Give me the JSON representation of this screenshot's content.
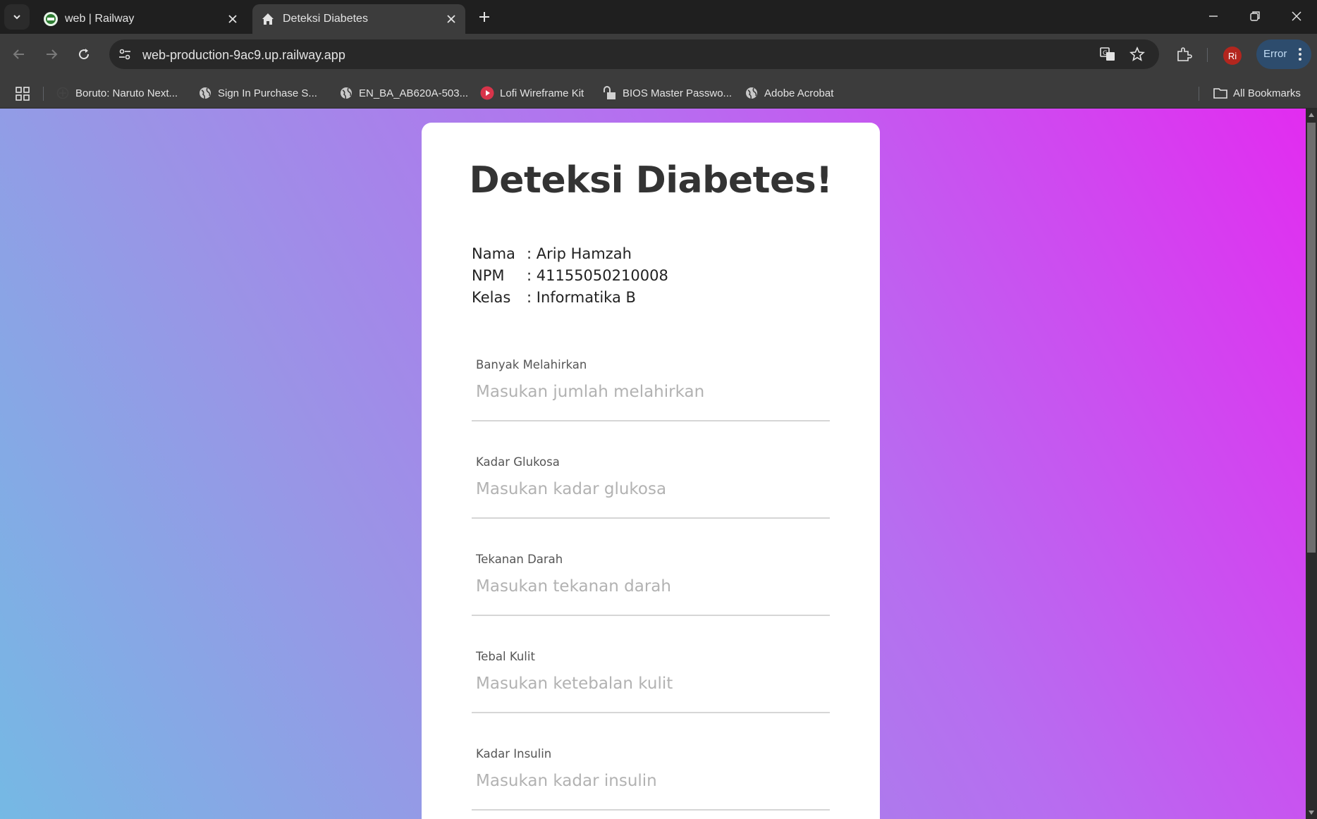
{
  "browser": {
    "tabs": [
      {
        "title": "web | Railway",
        "active": false,
        "favicon": "railway-icon"
      },
      {
        "title": "Deteksi Diabetes",
        "active": true,
        "favicon": "home-icon"
      }
    ],
    "url": "web-production-9ac9.up.railway.app",
    "profile_initials": "Ri",
    "status_chip": "Error",
    "bookmarks": [
      {
        "label": "Boruto: Naruto Next...",
        "icon": "plus-circle-icon"
      },
      {
        "label": "Sign In  Purchase  S...",
        "icon": "globe-icon"
      },
      {
        "label": "EN_BA_AB620A-503...",
        "icon": "globe-icon"
      },
      {
        "label": "Lofi Wireframe Kit",
        "icon": "play-icon"
      },
      {
        "label": "BIOS Master Passwo...",
        "icon": "lock-icon"
      },
      {
        "label": "Adobe Acrobat",
        "icon": "globe-icon"
      }
    ],
    "all_bookmarks": "All Bookmarks"
  },
  "page": {
    "title": "Deteksi Diabetes!",
    "info": [
      {
        "key": "Nama",
        "value": ": Arip Hamzah"
      },
      {
        "key": "NPM",
        "value": ": 41155050210008"
      },
      {
        "key": "Kelas",
        "value": ": Informatika B"
      }
    ],
    "fields": [
      {
        "label": "Banyak Melahirkan",
        "placeholder": "Masukan jumlah melahirkan",
        "value": ""
      },
      {
        "label": "Kadar Glukosa",
        "placeholder": "Masukan kadar glukosa",
        "value": ""
      },
      {
        "label": "Tekanan Darah",
        "placeholder": "Masukan tekanan darah",
        "value": ""
      },
      {
        "label": "Tebal Kulit",
        "placeholder": "Masukan ketebalan kulit",
        "value": ""
      },
      {
        "label": "Kadar Insulin",
        "placeholder": "Masukan kadar insulin",
        "value": ""
      }
    ]
  },
  "colors": {
    "gradient_start": "#75b9e4",
    "gradient_mid": "#b76df0",
    "gradient_end": "#e22cf0",
    "title_color": "#333333",
    "label_color": "#555555",
    "placeholder_color": "#b2b2b2"
  }
}
